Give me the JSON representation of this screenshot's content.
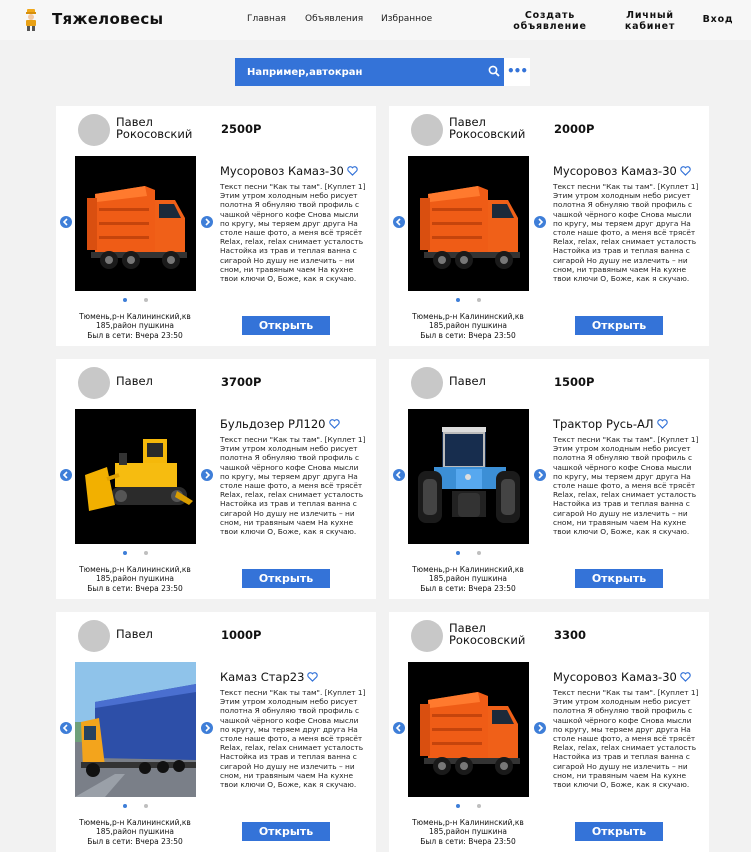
{
  "header": {
    "brand": "Тяжеловесы",
    "nav": [
      "Главная",
      "Объявления",
      "Избранное"
    ],
    "create_ad_line1": "Создать",
    "create_ad_line2": "объявление",
    "account_line1": "Личный",
    "account_line2": "кабинет",
    "login": "Вход"
  },
  "search": {
    "placeholder": "Например,автокран"
  },
  "common": {
    "description": "Текст песни \"Как ты там\". [Куплет 1] Этим утром холодным небо рисует полотна Я обнуляю твой профиль с чашкой чёрного кофе Снова мысли по кругу, мы теряем друг друга На столе наше фото, а меня всё трясёт Relax, relax, relax снимает усталость Настойка из трав и теплая ванна с сигарой Но душу не излечить – ни сном, ни травяным чаем На кухне твои ключи О, Боже, как я скучаю.",
    "location": "Тюмень,р-н Калининский,кв 185,район пушкина",
    "online": "Был в сети: Вчера 23:50",
    "open_button": "Открыть"
  },
  "cards": [
    {
      "seller": "Павел Рокосовский",
      "price": "2500Р",
      "title": "Мусоровоз Камаз-30",
      "image": "garbage-truck"
    },
    {
      "seller": "Павел Рокосовский",
      "price": "2000Р",
      "title": "Мусоровоз Камаз-30",
      "image": "garbage-truck"
    },
    {
      "seller": "Павел",
      "price": "3700Р",
      "title": "Бульдозер РЛ120",
      "image": "bulldozer"
    },
    {
      "seller": "Павел",
      "price": "1500Р",
      "title": "Трактор Русь-АЛ",
      "image": "tractor"
    },
    {
      "seller": "Павел",
      "price": "1000Р",
      "title": "Камаз Стар23",
      "image": "semi-truck"
    },
    {
      "seller": "Павел Рокосовский",
      "price": "3300",
      "title": "Мусоровоз Камаз-30",
      "image": "garbage-truck"
    }
  ],
  "colors": {
    "accent": "#3473d8",
    "background": "#f2f2f2",
    "card": "#ffffff"
  }
}
